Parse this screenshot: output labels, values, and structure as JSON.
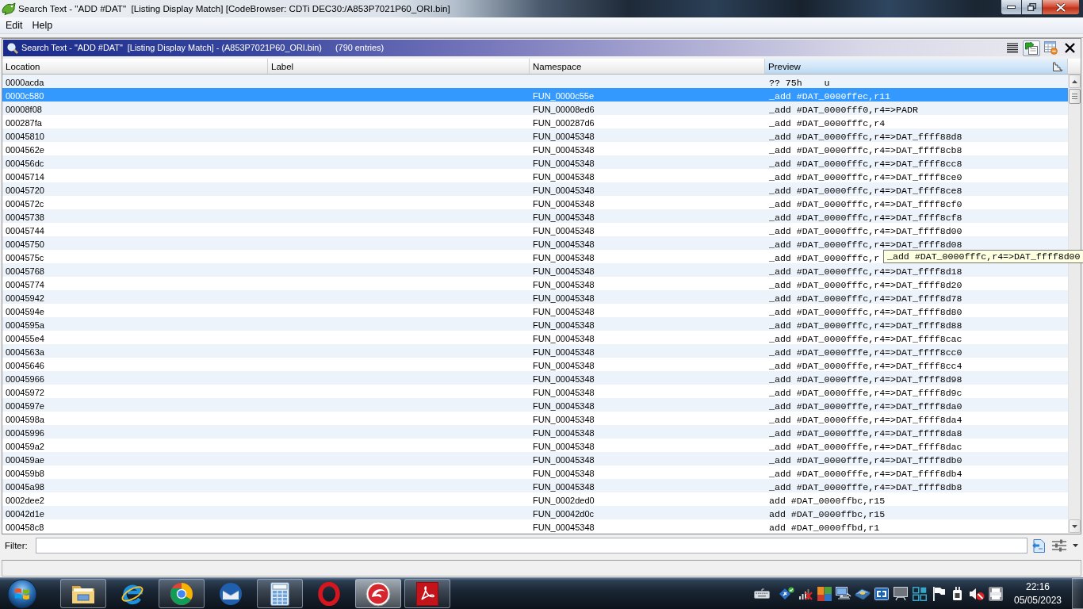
{
  "window": {
    "title": "Search Text - \"ADD #DAT\"  [Listing Display Match] [CodeBrowser: CDTi DEC30:/A853P7021P60_ORI.bin]"
  },
  "menu": [
    {
      "label": "Edit"
    },
    {
      "label": "Help"
    }
  ],
  "panel": {
    "title": "Search Text - \"ADD #DAT\"  [Listing Display Match] - (A853P7021P60_ORI.bin)",
    "count": "(790 entries)",
    "toolbar": [
      {
        "kind": "list",
        "pressed": false
      },
      {
        "kind": "go",
        "pressed": true
      },
      {
        "kind": "table",
        "pressed": false
      },
      {
        "kind": "close",
        "pressed": false
      }
    ]
  },
  "table": {
    "columns": [
      {
        "label": "Location",
        "sorted": false
      },
      {
        "label": "Label",
        "sorted": false
      },
      {
        "label": "Namespace",
        "sorted": false
      },
      {
        "label": "Preview",
        "sorted": true
      }
    ],
    "rows": [
      {
        "location": "0000acda",
        "preview": "?? 75h    u",
        "selected": false
      },
      {
        "location": "0000c580",
        "namespace": "FUN_0000c55e",
        "preview": "_add #DAT_0000ffec,r11",
        "selected": true
      },
      {
        "location": "00008f08",
        "namespace": "FUN_00008ed6",
        "preview": "_add #DAT_0000fff0,r4=>PADR",
        "selected": false
      },
      {
        "location": "000287fa",
        "namespace": "FUN_000287d6",
        "preview": "_add #DAT_0000fffc,r4",
        "selected": false
      },
      {
        "location": "00045810",
        "namespace": "FUN_00045348",
        "preview": "_add #DAT_0000fffc,r4=>DAT_ffff88d8",
        "selected": false
      },
      {
        "location": "0004562e",
        "namespace": "FUN_00045348",
        "preview": "_add #DAT_0000fffc,r4=>DAT_ffff8cb8",
        "selected": false
      },
      {
        "location": "000456dc",
        "namespace": "FUN_00045348",
        "preview": "_add #DAT_0000fffc,r4=>DAT_ffff8cc8",
        "selected": false
      },
      {
        "location": "00045714",
        "namespace": "FUN_00045348",
        "preview": "_add #DAT_0000fffc,r4=>DAT_ffff8ce0",
        "selected": false
      },
      {
        "location": "00045720",
        "namespace": "FUN_00045348",
        "preview": "_add #DAT_0000fffc,r4=>DAT_ffff8ce8",
        "selected": false
      },
      {
        "location": "0004572c",
        "namespace": "FUN_00045348",
        "preview": "_add #DAT_0000fffc,r4=>DAT_ffff8cf0",
        "selected": false
      },
      {
        "location": "00045738",
        "namespace": "FUN_00045348",
        "preview": "_add #DAT_0000fffc,r4=>DAT_ffff8cf8",
        "selected": false
      },
      {
        "location": "00045744",
        "namespace": "FUN_00045348",
        "preview": "_add #DAT_0000fffc,r4=>DAT_ffff8d00",
        "selected": false
      },
      {
        "location": "00045750",
        "namespace": "FUN_00045348",
        "preview": "_add #DAT_0000fffc,r4=>DAT_ffff8d08",
        "selected": false
      },
      {
        "location": "0004575c",
        "namespace": "FUN_00045348",
        "preview": "_add #DAT_0000fffc,r",
        "tooltip": "_add #DAT_0000fffc,r4=>DAT_ffff8d00",
        "selected": false
      },
      {
        "location": "00045768",
        "namespace": "FUN_00045348",
        "preview": "_add #DAT_0000fffc,r4=>DAT_ffff8d18",
        "selected": false
      },
      {
        "location": "00045774",
        "namespace": "FUN_00045348",
        "preview": "_add #DAT_0000fffc,r4=>DAT_ffff8d20",
        "selected": false
      },
      {
        "location": "00045942",
        "namespace": "FUN_00045348",
        "preview": "_add #DAT_0000fffc,r4=>DAT_ffff8d78",
        "selected": false
      },
      {
        "location": "0004594e",
        "namespace": "FUN_00045348",
        "preview": "_add #DAT_0000fffc,r4=>DAT_ffff8d80",
        "selected": false
      },
      {
        "location": "0004595a",
        "namespace": "FUN_00045348",
        "preview": "_add #DAT_0000fffc,r4=>DAT_ffff8d88",
        "selected": false
      },
      {
        "location": "000455e4",
        "namespace": "FUN_00045348",
        "preview": "_add #DAT_0000fffe,r4=>DAT_ffff8cac",
        "selected": false
      },
      {
        "location": "0004563a",
        "namespace": "FUN_00045348",
        "preview": "_add #DAT_0000fffe,r4=>DAT_ffff8cc0",
        "selected": false
      },
      {
        "location": "00045646",
        "namespace": "FUN_00045348",
        "preview": "_add #DAT_0000fffe,r4=>DAT_ffff8cc4",
        "selected": false
      },
      {
        "location": "00045966",
        "namespace": "FUN_00045348",
        "preview": "_add #DAT_0000fffe,r4=>DAT_ffff8d98",
        "selected": false
      },
      {
        "location": "00045972",
        "namespace": "FUN_00045348",
        "preview": "_add #DAT_0000fffe,r4=>DAT_ffff8d9c",
        "selected": false
      },
      {
        "location": "0004597e",
        "namespace": "FUN_00045348",
        "preview": "_add #DAT_0000fffe,r4=>DAT_ffff8da0",
        "selected": false
      },
      {
        "location": "0004598a",
        "namespace": "FUN_00045348",
        "preview": "_add #DAT_0000fffe,r4=>DAT_ffff8da4",
        "selected": false
      },
      {
        "location": "00045996",
        "namespace": "FUN_00045348",
        "preview": "_add #DAT_0000fffe,r4=>DAT_ffff8da8",
        "selected": false
      },
      {
        "location": "000459a2",
        "namespace": "FUN_00045348",
        "preview": "_add #DAT_0000fffe,r4=>DAT_ffff8dac",
        "selected": false
      },
      {
        "location": "000459ae",
        "namespace": "FUN_00045348",
        "preview": "_add #DAT_0000fffe,r4=>DAT_ffff8db0",
        "selected": false
      },
      {
        "location": "000459b8",
        "namespace": "FUN_00045348",
        "preview": "_add #DAT_0000fffe,r4=>DAT_ffff8db4",
        "selected": false
      },
      {
        "location": "00045a98",
        "namespace": "FUN_00045348",
        "preview": "_add #DAT_0000fffe,r4=>DAT_ffff8db8",
        "selected": false
      },
      {
        "location": "0002dee2",
        "namespace": "FUN_0002ded0",
        "preview": "add #DAT_0000ffbc,r15",
        "selected": false
      },
      {
        "location": "00042d1e",
        "namespace": "FUN_00042d0c",
        "preview": "add #DAT_0000ffbc,r15",
        "selected": false
      },
      {
        "location": "000458c8",
        "namespace": "FUN_00045348",
        "preview": "add #DAT_0000ffbd,r1",
        "selected": false
      }
    ]
  },
  "filter": {
    "label": "Filter:"
  },
  "taskbar": {
    "items": [
      {
        "kind": "folder",
        "running": true,
        "active": false
      },
      {
        "kind": "globe",
        "running": false,
        "active": false
      },
      {
        "kind": "wheel",
        "running": true,
        "active": false
      },
      {
        "kind": "mail",
        "running": false,
        "active": false
      },
      {
        "kind": "calculator",
        "running": true,
        "active": false
      },
      {
        "kind": "ring",
        "running": false,
        "active": false
      },
      {
        "kind": "swirl",
        "running": true,
        "active": true
      },
      {
        "kind": "document",
        "running": true,
        "active": false
      }
    ],
    "clock": {
      "time": "22:16",
      "date": "05/05/2023"
    }
  }
}
